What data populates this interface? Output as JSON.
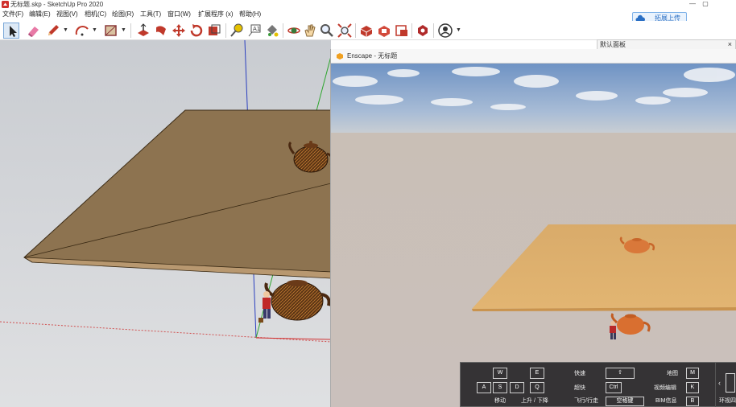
{
  "window": {
    "title": "无标题.skp - SketchUp Pro 2020",
    "minimize": "—",
    "restore": "▢"
  },
  "menu": [
    "文件(F)",
    "编辑(E)",
    "视图(V)",
    "相机(C)",
    "绘图(R)",
    "工具(T)",
    "窗口(W)",
    "扩展程序 (x)",
    "帮助(H)"
  ],
  "upload_button": {
    "label": "拓展上传"
  },
  "tray": {
    "title": "默认面板",
    "close": "×"
  },
  "toolbar": {
    "tools": [
      "select-icon",
      "eraser-icon",
      "pencil-icon",
      "arc-icon",
      "rectangle-icon",
      "push-pull-icon",
      "follow-me-icon",
      "move-icon",
      "rotate-icon",
      "scale-icon",
      "tape-measure-icon",
      "text-icon",
      "paint-bucket-icon",
      "orbit-icon",
      "zoom-icon",
      "zoom-extents-icon",
      "3d-warehouse-icon",
      "extension-warehouse-icon",
      "layout-icon",
      "extension-manager-icon",
      "account-icon"
    ]
  },
  "enscape": {
    "title": "Enscape - 无标题",
    "controls": {
      "keys": {
        "w": "W",
        "a": "A",
        "s": "S",
        "d": "D",
        "e": "E",
        "q": "Q",
        "shift": "⇧",
        "ctrl": "Ctrl",
        "space": "空格键",
        "m": "M",
        "k": "K",
        "b": "B"
      },
      "labels": {
        "move": "移动",
        "up_down": "上升 / 下降",
        "fast": "快速",
        "super_fast": "超快",
        "fly_walk": "飞行/行走",
        "map": "地图",
        "video_editor": "视频编辑",
        "bim_info": "BIM信息",
        "env": "环视四"
      }
    }
  },
  "colors": {
    "accent": "#2a6fc4",
    "viewport_bg": "#d6d8dc",
    "plane": "#8c7350",
    "render_plane": "#d9a865"
  }
}
